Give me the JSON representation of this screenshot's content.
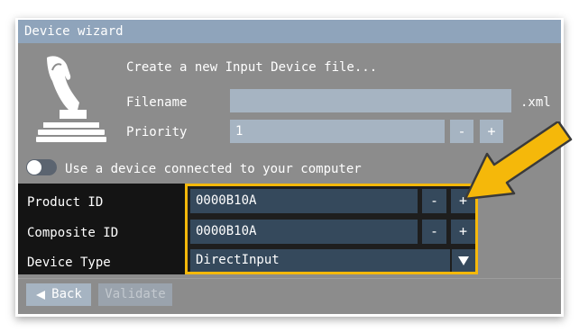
{
  "window": {
    "title": "Device wizard"
  },
  "header": {
    "text": "Create a new Input Device file..."
  },
  "filename": {
    "label": "Filename",
    "value": "",
    "extension": ".xml"
  },
  "priority": {
    "label": "Priority",
    "value": "1",
    "minus": "-",
    "plus": "+"
  },
  "connected_toggle": {
    "label": "Use a device connected to your computer",
    "on": false
  },
  "device": {
    "product_id": {
      "label": "Product ID",
      "value": "0000B10A",
      "minus": "-",
      "plus": "+"
    },
    "composite_id": {
      "label": "Composite ID",
      "value": "0000B10A",
      "minus": "-",
      "plus": "+"
    },
    "device_type": {
      "label": "Device Type",
      "value": "DirectInput"
    }
  },
  "footer": {
    "back_label": "Back",
    "validate_label": "Validate"
  },
  "icons": [
    "joystick-icon",
    "chevron-down-icon",
    "back-arrow-icon",
    "callout-arrow-icon"
  ],
  "colors": {
    "titlebar": "#8fa4bb",
    "dialog_bg": "#8c8c8c",
    "panel_bg": "#141414",
    "field_dark": "#35495c",
    "highlight": "#f5b80a"
  }
}
